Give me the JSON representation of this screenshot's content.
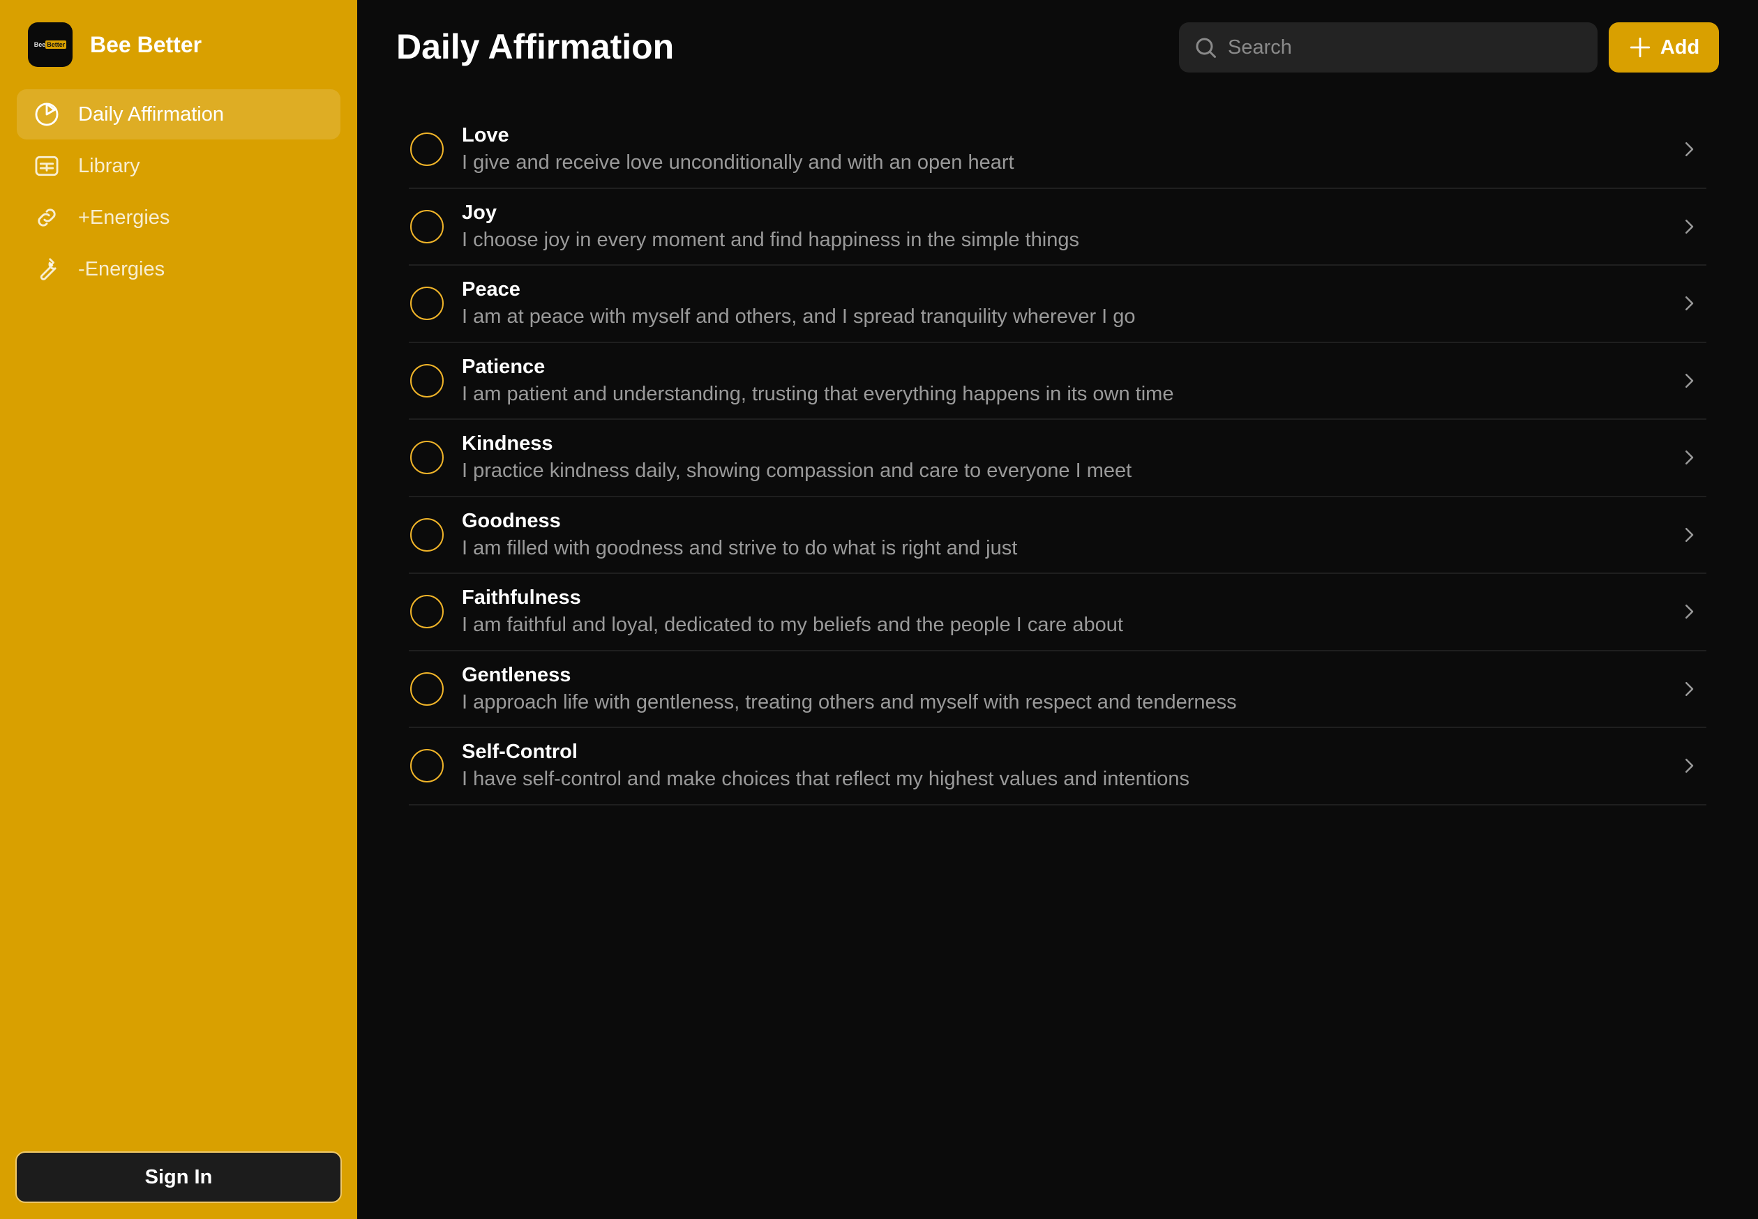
{
  "app": {
    "name": "Bee Better",
    "logo_text_left": "Bee",
    "logo_text_right": "Better"
  },
  "colors": {
    "accent": "#d9a000",
    "background": "#0b0b0b",
    "circle": "#f0b429"
  },
  "sidebar": {
    "items": [
      {
        "label": "Daily Affirmation",
        "icon": "pie-chart-icon",
        "active": true
      },
      {
        "label": "Library",
        "icon": "table-icon",
        "active": false
      },
      {
        "label": "+Energies",
        "icon": "link-icon",
        "active": false
      },
      {
        "label": "-Energies",
        "icon": "wrench-icon",
        "active": false
      }
    ],
    "sign_in_label": "Sign In"
  },
  "header": {
    "title": "Daily Affirmation",
    "search_placeholder": "Search",
    "add_label": "Add"
  },
  "affirmations": [
    {
      "title": "Love",
      "text": "I give and receive love unconditionally and with an open heart"
    },
    {
      "title": "Joy",
      "text": "I choose joy in every moment and find happiness in the simple things"
    },
    {
      "title": "Peace",
      "text": "I am at peace with myself and others, and I spread tranquility wherever I go"
    },
    {
      "title": "Patience",
      "text": "I am patient and understanding, trusting that everything happens in its own time"
    },
    {
      "title": "Kindness",
      "text": "I practice kindness daily, showing compassion and care to everyone I meet"
    },
    {
      "title": "Goodness",
      "text": "I am filled with goodness and strive to do what is right and just"
    },
    {
      "title": "Faithfulness",
      "text": "I am faithful and loyal, dedicated to my beliefs and the people I care about"
    },
    {
      "title": "Gentleness",
      "text": "I approach life with gentleness, treating others and myself with respect and tenderness"
    },
    {
      "title": "Self-Control",
      "text": "I have self-control and make choices that reflect my highest values and intentions"
    }
  ]
}
